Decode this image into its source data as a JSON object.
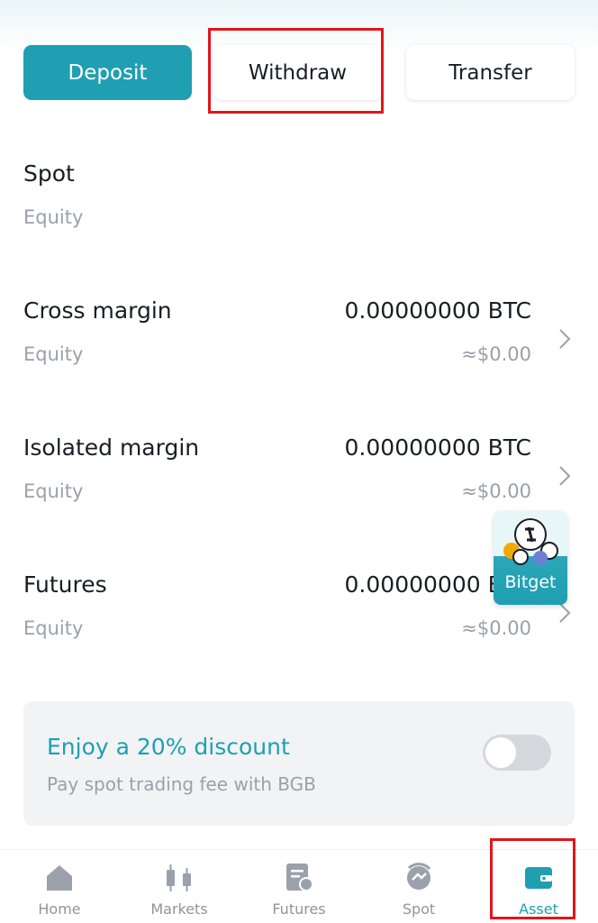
{
  "actions": {
    "deposit": "Deposit",
    "withdraw": "Withdraw",
    "transfer": "Transfer"
  },
  "accounts": [
    {
      "name": "Spot",
      "sub": "Equity",
      "value": "",
      "usd": ""
    },
    {
      "name": "Cross margin",
      "sub": "Equity",
      "value": "0.00000000 BTC",
      "usd": "≈$0.00"
    },
    {
      "name": "Isolated margin",
      "sub": "Equity",
      "value": "0.00000000 BTC",
      "usd": "≈$0.00"
    },
    {
      "name": "Futures",
      "sub": "Equity",
      "value": "0.00000000 BTC",
      "usd": "≈$0.00"
    }
  ],
  "floating_badge": {
    "label": "Bitget"
  },
  "promo": {
    "title": "Enjoy a 20% discount",
    "subtitle": "Pay spot trading fee with BGB",
    "toggle_on": false
  },
  "nav": {
    "items": [
      {
        "label": "Home",
        "icon": "home-icon"
      },
      {
        "label": "Markets",
        "icon": "candlestick-icon"
      },
      {
        "label": "Futures",
        "icon": "futures-icon"
      },
      {
        "label": "Spot",
        "icon": "spot-icon"
      },
      {
        "label": "Asset",
        "icon": "wallet-icon",
        "active": true
      }
    ]
  },
  "colors": {
    "accent": "#1f9fb1",
    "highlight": "#e0161c",
    "muted": "#9aa1aa"
  }
}
